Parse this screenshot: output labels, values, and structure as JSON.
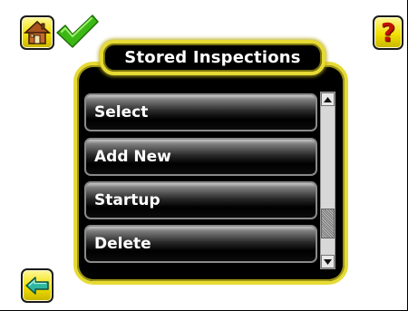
{
  "header": {
    "title": "Stored Inspections",
    "home_icon": "home-icon",
    "status_icon": "checkmark-icon",
    "help_icon": "help-icon",
    "help_glyph": "?"
  },
  "menu": {
    "items": [
      {
        "label": "Select"
      },
      {
        "label": "Add New"
      },
      {
        "label": "Startup"
      },
      {
        "label": "Delete"
      }
    ],
    "scroll_position": 0.85
  },
  "footer": {
    "back_icon": "back-arrow-icon"
  },
  "colors": {
    "accent_yellow": "#e6da35",
    "button_yellow": "#f1e000",
    "check_green": "#3cb814",
    "panel_black": "#000000"
  }
}
